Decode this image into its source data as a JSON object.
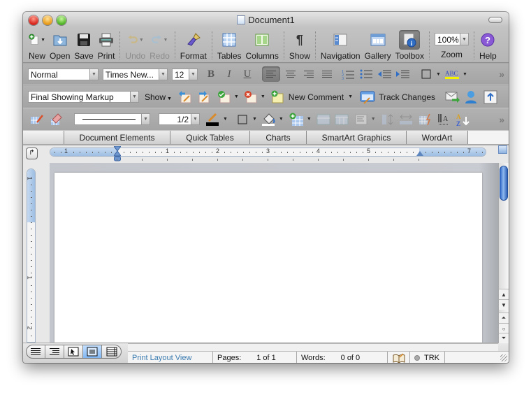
{
  "window": {
    "title": "Document1"
  },
  "standard_toolbar": {
    "items": [
      {
        "label": "New",
        "icon": "new-document-icon",
        "has_dropdown": true,
        "enabled": true
      },
      {
        "label": "Open",
        "icon": "open-folder-icon",
        "enabled": true
      },
      {
        "label": "Save",
        "icon": "floppy-disk-icon",
        "enabled": true
      },
      {
        "label": "Print",
        "icon": "printer-icon",
        "enabled": true
      },
      {
        "label": "Undo",
        "icon": "undo-icon",
        "has_dropdown": true,
        "enabled": false
      },
      {
        "label": "Redo",
        "icon": "redo-icon",
        "has_dropdown": true,
        "enabled": false
      },
      {
        "label": "Format",
        "icon": "paintbrush-icon",
        "enabled": true
      },
      {
        "label": "Tables",
        "icon": "table-grid-icon",
        "enabled": true
      },
      {
        "label": "Columns",
        "icon": "columns-icon",
        "enabled": true
      },
      {
        "label": "Show",
        "icon": "pilcrow-icon",
        "enabled": true
      },
      {
        "label": "Navigation",
        "icon": "navigation-pane-icon",
        "enabled": true
      },
      {
        "label": "Gallery",
        "icon": "gallery-icon",
        "enabled": true
      },
      {
        "label": "Toolbox",
        "icon": "toolbox-info-icon",
        "enabled": true,
        "active": true
      },
      {
        "label": "Zoom",
        "value": "100%"
      },
      {
        "label": "Help",
        "icon": "help-question-icon",
        "enabled": true
      }
    ]
  },
  "formatting": {
    "style": "Normal",
    "font": "Times New...",
    "size": "12",
    "bold": "B",
    "italic": "I",
    "underline": "U"
  },
  "review": {
    "markup_mode": "Final Showing Markup",
    "show_label": "Show",
    "new_comment_label": "New Comment",
    "track_changes_label": "Track Changes"
  },
  "tables": {
    "line_weight": "1/2"
  },
  "ribbon": {
    "tabs": [
      "Document Elements",
      "Quick Tables",
      "Charts",
      "SmartArt Graphics",
      "WordArt"
    ]
  },
  "ruler": {
    "horizontal_labels": [
      "1",
      "1",
      "2",
      "3",
      "4",
      "5",
      "7"
    ],
    "vertical_labels": [
      "1",
      "1",
      "2"
    ]
  },
  "statusbar": {
    "view_name": "Print Layout View",
    "pages_label": "Pages:",
    "pages_value": "1 of 1",
    "words_label": "Words:",
    "words_value": "0 of 0",
    "track_label": "TRK"
  }
}
